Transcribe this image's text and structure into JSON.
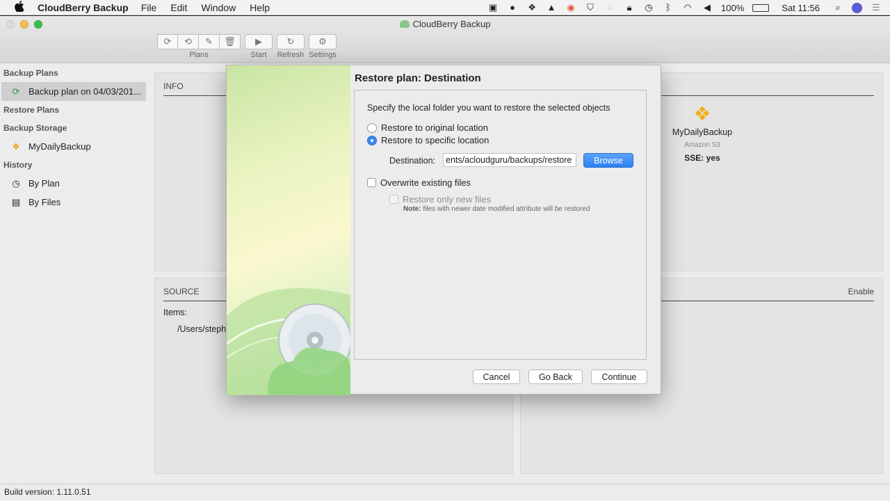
{
  "menubar": {
    "app_name": "CloudBerry Backup",
    "items": [
      "File",
      "Edit",
      "Window",
      "Help"
    ],
    "battery": "100%",
    "clock": "Sat 11:56"
  },
  "window": {
    "title": "CloudBerry Backup"
  },
  "toolbar": {
    "plans_label": "Plans",
    "start_label": "Start",
    "refresh_label": "Refresh",
    "settings_label": "Settings"
  },
  "sidebar": {
    "backup_plans_header": "Backup Plans",
    "backup_plan_item": "Backup plan on 04/03/201...",
    "restore_plans_header": "Restore Plans",
    "backup_storage_header": "Backup Storage",
    "storage_item": "MyDailyBackup",
    "history_header": "History",
    "history_by_plan": "By Plan",
    "history_by_files": "By Files"
  },
  "info_panel": {
    "title": "INFO",
    "storage_name": "MyDailyBackup",
    "storage_provider": "Amazon S3",
    "sse_label": "SSE:",
    "sse_value": "yes"
  },
  "source_panel": {
    "title": "SOURCE",
    "items_label": "Items:",
    "item_path": "/Users/steph",
    "right_label": "Enable"
  },
  "status_bar": {
    "build_version": "Build version: 1.11.0.51"
  },
  "dialog": {
    "title": "Restore plan: Destination",
    "instruction": "Specify the local folder you want to restore the selected objects",
    "option_original": "Restore to original location",
    "option_specific": "Restore to specific location",
    "destination_label": "Destination:",
    "destination_value": "ents/acloudguru/backups/restore",
    "browse_label": "Browse",
    "overwrite_label": "Overwrite existing files",
    "only_new_label": "Restore only new files",
    "note_prefix": "Note:",
    "note_text": "files with newer date modified attribute will be restored",
    "cancel_label": "Cancel",
    "go_back_label": "Go Back",
    "continue_label": "Continue"
  },
  "colors": {
    "accent": "#3a87f0",
    "panel_bg": "#e4e4e4",
    "window_bg": "#ececec"
  }
}
